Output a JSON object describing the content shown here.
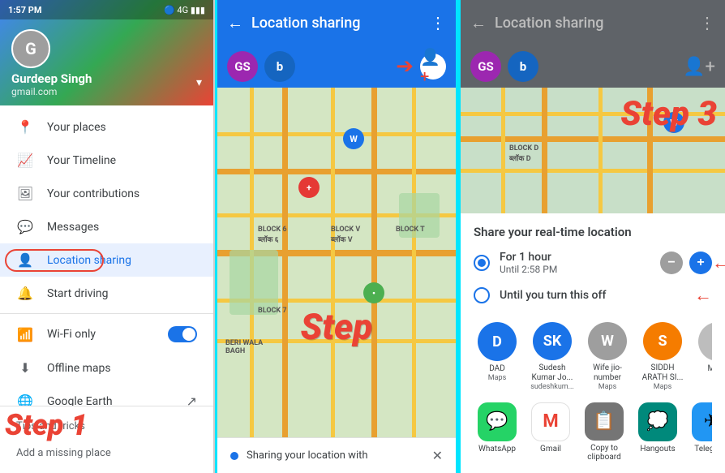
{
  "panel1": {
    "statusBar": {
      "time": "1:57 PM",
      "icons": "▲ 4G ▮▮▮"
    },
    "user": {
      "name": "Gurdeep Singh",
      "email": "gmail.com",
      "avatarInitial": "G"
    },
    "menuItems": [
      {
        "id": "your-places",
        "icon": "📍",
        "label": "Your places"
      },
      {
        "id": "your-timeline",
        "icon": "📈",
        "label": "Your Timeline"
      },
      {
        "id": "your-contributions",
        "icon": "🖼",
        "label": "Your contributions"
      },
      {
        "id": "messages",
        "icon": "💬",
        "label": "Messages"
      },
      {
        "id": "location-sharing",
        "icon": "👤",
        "label": "Location sharing",
        "active": true
      },
      {
        "id": "start-driving",
        "icon": "🔔",
        "label": "Start driving"
      },
      {
        "id": "wifi-only",
        "icon": "📶",
        "label": "Wi-Fi only",
        "hasToggle": true
      },
      {
        "id": "offline-maps",
        "icon": "⬇",
        "label": "Offline maps"
      },
      {
        "id": "google-earth",
        "icon": "🌐",
        "label": "Google Earth",
        "hasArrow": true
      }
    ],
    "bottomLinks": [
      {
        "id": "tips",
        "label": "Tips and tricks"
      },
      {
        "id": "add-missing",
        "label": "Add a missing place"
      }
    ],
    "step1Label": "Step 1"
  },
  "panel2": {
    "appBar": {
      "title": "Location sharing",
      "backIcon": "←",
      "menuIcon": "⋮"
    },
    "contacts": [
      {
        "initials": "GS",
        "color": "#9c27b0"
      },
      {
        "initials": "B",
        "color": "#1565c0"
      }
    ],
    "addContactIcon": "+👤",
    "sharingFooter": {
      "text": "Sharing your location with"
    },
    "stepLabel": "Step"
  },
  "panel3": {
    "appBar": {
      "title": "Location sharing",
      "backIcon": "←",
      "menuIcon": "⋮"
    },
    "contacts": [
      {
        "initials": "GS",
        "color": "#9c27b0"
      },
      {
        "initials": "B",
        "color": "#1565c0"
      }
    ],
    "addContactIcon": "+👤",
    "step3Label": "Step 3",
    "sharePanel": {
      "title": "Share your real-time location",
      "options": [
        {
          "id": "one-hour",
          "label": "For 1 hour",
          "sublabel": "Until 2:58 PM",
          "selected": true,
          "hasControls": true
        },
        {
          "id": "until-off",
          "label": "Until you turn this off",
          "selected": false,
          "hasControls": false
        }
      ],
      "contacts": [
        {
          "name": "DAD",
          "sublabel": "Maps",
          "color": "#1a73e8",
          "initials": "D"
        },
        {
          "name": "Sudesh Kumar Jo...",
          "sublabel": "sudeshkum...",
          "color": "#1a73e8",
          "initials": "SK"
        },
        {
          "name": "Wife jio-number",
          "sublabel": "Maps",
          "color": "#9e9e9e",
          "initials": "W"
        },
        {
          "name": "SIDDH ARATH SI...",
          "sublabel": "Maps",
          "color": "#f57c00",
          "initials": "S"
        }
      ],
      "apps": [
        {
          "name": "WhatsApp",
          "color": "#25d366",
          "icon": "💬"
        },
        {
          "name": "Gmail",
          "color": "#ea4335",
          "icon": "M"
        },
        {
          "name": "Copy to clipboard",
          "color": "#757575",
          "icon": "📋"
        },
        {
          "name": "Hangouts",
          "color": "#00897b",
          "icon": "💭"
        },
        {
          "name": "Telegram",
          "color": "#2196f3",
          "icon": "✈"
        }
      ]
    }
  }
}
